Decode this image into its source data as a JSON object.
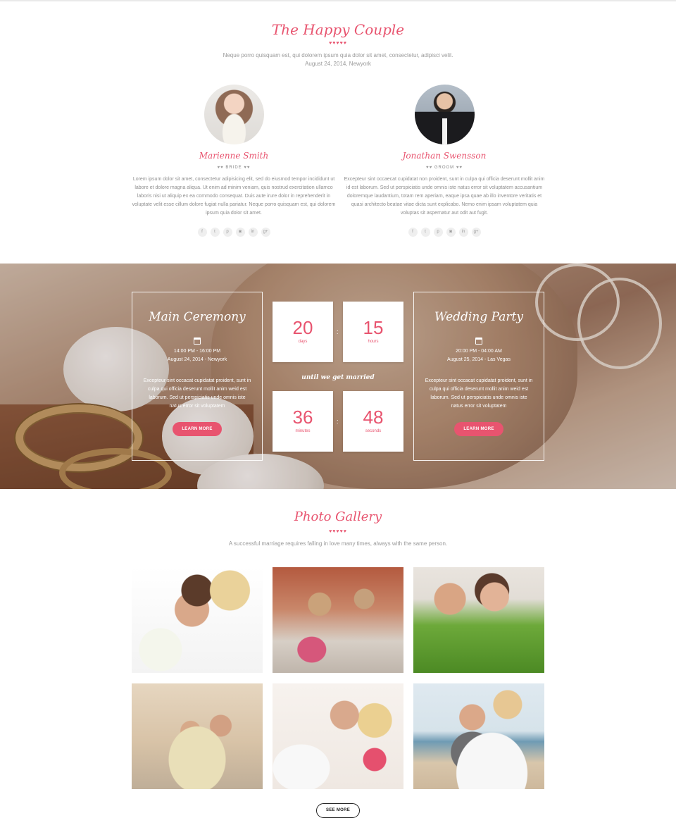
{
  "couple": {
    "title": "The Happy Couple",
    "hearts": "♥♥♥♥♥",
    "intro_line1": "Neque porro quisquam est, qui dolorem ipsum quia dolor sit amet, consectetur, adipisci velit.",
    "intro_line2": "August 24, 2014, Newyork",
    "bride": {
      "name": "Marienne Smith",
      "role": "BRIDE",
      "bio": "Lorem ipsum dolor sit amet, consectetur adipisicing elit, sed do eiusmod tempor incididunt ut labore et dolore magna aliqua. Ut enim ad minim veniam, quis nostrud exercitation ullamco laboris nisi ut aliquip ex ea commodo consequat. Duis aute irure dolor in reprehenderit in voluptate velit esse cillum dolore fugiat nulla pariatur. Neque porro quisquam est, qui dolorem ipsum quia dolor sit amet."
    },
    "groom": {
      "name": "Jonathan Swensson",
      "role": "GROOM",
      "bio": "Excepteur sint occaecat cupidatat non proident, sunt in culpa qui officia deserunt mollit anim id est laborum. Sed ut perspiciatis unde omnis iste natus error sit voluptatem accusantium doloremque laudantium, totam rem aperiam, eaque ipsa quae ab illo inventore veritatis et quasi architecto beatae vitae dicta sunt explicabo. Nemo enim ipsam voluptatem quia voluptas sit aspernatur aut odit aut fugit."
    },
    "social_icons": [
      {
        "name": "facebook-icon",
        "glyph": "f"
      },
      {
        "name": "twitter-icon",
        "glyph": "t"
      },
      {
        "name": "pinterest-icon",
        "glyph": "p"
      },
      {
        "name": "instagram-icon",
        "glyph": "◙"
      },
      {
        "name": "linkedin-icon",
        "glyph": "in"
      },
      {
        "name": "google-plus-icon",
        "glyph": "g+"
      }
    ]
  },
  "events": {
    "ceremony": {
      "title": "Main Ceremony",
      "time": "14:00 PM - 16:00 PM",
      "place": "August 24, 2014 - Newyork",
      "desc": "Excepteur sint occacat cupidatat proident, sunt in culpa qui officia deserunt mollit anim weid est laborum. Sed ut perspiciatis unde omnis iste natus error sit voluptatem",
      "button": "LEARN MORE"
    },
    "party": {
      "title": "Wedding Party",
      "time": "20:00 PM - 04:00 AM",
      "place": "August 25, 2014 - Las Vegas",
      "desc": "Excepteur sint occacat cupidatat proident, sunt in culpa qui officia deserunt mollit anim weid est laborum. Sed ut perspiciatis unde omnis iste natus error sit voluptatem",
      "button": "LEARN MORE"
    },
    "countdown": {
      "days": {
        "value": "20",
        "label": "days"
      },
      "hours": {
        "value": "15",
        "label": "hours"
      },
      "minutes": {
        "value": "36",
        "label": "minutes"
      },
      "seconds": {
        "value": "48",
        "label": "seconds"
      },
      "caption": "until we get married",
      "separator": ":"
    }
  },
  "gallery": {
    "title": "Photo Gallery",
    "hearts": "♥♥♥♥♥",
    "subtitle": "A successful marriage requires falling in love many times, always with the same person.",
    "see_more": "SEE MORE"
  },
  "colors": {
    "accent": "#e8546f",
    "text": "#8e8e8e",
    "button_text": "#222222"
  }
}
